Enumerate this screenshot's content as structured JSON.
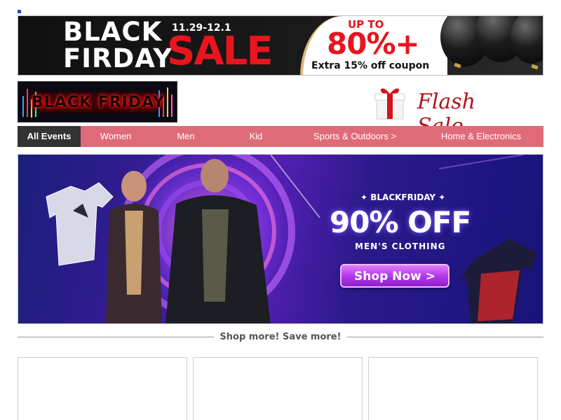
{
  "top_banner": {
    "black_friday": "BLACK FIRDAY",
    "dates": "11.29-12.1",
    "sale": "SALE",
    "up_to": "UP TO",
    "percent": "80%+",
    "coupon": "Extra 15% off coupon"
  },
  "logo": {
    "text": "BLACK FRIDAY"
  },
  "flash_sale": {
    "label": "Flash Sale",
    "icon": "gift-box-icon"
  },
  "nav": {
    "items": [
      {
        "label": "All Events",
        "active": true
      },
      {
        "label": "Women",
        "active": false
      },
      {
        "label": "Men",
        "active": false
      },
      {
        "label": "Kid",
        "active": false
      },
      {
        "label": "Sports & Outdoors >",
        "active": false
      },
      {
        "label": "Home & Electronics",
        "active": false
      }
    ]
  },
  "hero": {
    "eyebrow": "BLACKFRIDAY",
    "headline": "90% OFF",
    "subline": "MEN'S CLOTHING",
    "cta": "Shop Now >"
  },
  "section": {
    "divider_text": "Shop more! Save more!"
  },
  "colors": {
    "nav_bg": "#e06b78",
    "nav_active": "#333333",
    "sale_red": "#e8141e",
    "flash_red": "#b5121b",
    "cta_purple": "#b43be8"
  }
}
